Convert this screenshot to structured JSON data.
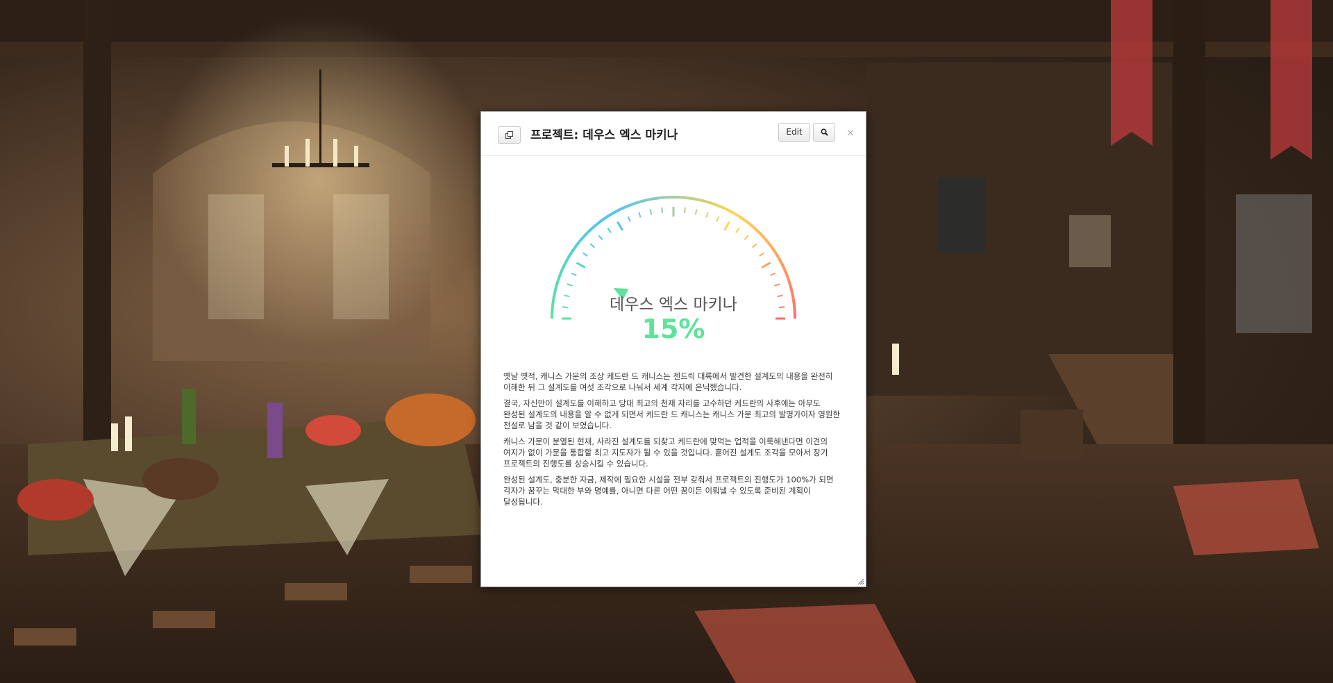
{
  "dialog": {
    "title": "프로젝트: 데우스 엑스 마키나",
    "edit_label": "Edit",
    "close_label": "×",
    "icons": {
      "copy": "copy-window-icon",
      "search": "magnifier-icon",
      "close": "close-x-icon",
      "resize": "resize-grip-icon"
    }
  },
  "gauge": {
    "name": "데우스 엑스 마키나",
    "percent_text": "15%",
    "progress_fraction": 0.15,
    "colors": {
      "start": "#5de39a",
      "cool": "#4fc3f7",
      "warm": "#ffd54f",
      "hot": "#ff6b6b",
      "needle": "#5de39a"
    }
  },
  "description": {
    "paragraphs": [
      "옛날 옛적, 캐니스 가문의 조상 케드란 드 캐니스는 젠드릭 대륙에서 발견한 설계도의 내용을 완전히 이해한 뒤 그 설계도를 여섯 조각으로 나눠서 세계 각지에 은닉했습니다.",
      "결국, 자신만이 설계도를 이해하고 당대 최고의 천재 자리를 고수하던 케드란의 사후에는 아무도 완성된 설계도의 내용을 알 수 없게 되면서 케드란 드 캐니스는 캐니스 가문 최고의 발명가이자 영원한 전설로 남을 것 같이 보였습니다.",
      "캐니스 가문이 분열된 현재, 사라진 설계도를 되찾고 케드란에 맞먹는 업적을 이룩해낸다면 이견의 여지가 없이 가문을 통합할 최고 지도자가 될 수 있을 것입니다. 흩어진 설계도 조각을 모아서 장기 프로젝트의 진행도를 상승시킬 수 있습니다.",
      "완성된 설계도, 충분한 자금, 제작에 필요한 시설을 전부 갖춰서 프로젝트의 진행도가 100%가 되면 각자가 꿈꾸는 막대한 부와 명예를, 아니면 다른 어떤 꿈이든 이뤄낼 수 있도록 준비된 계획이 달성됩니다."
    ]
  }
}
